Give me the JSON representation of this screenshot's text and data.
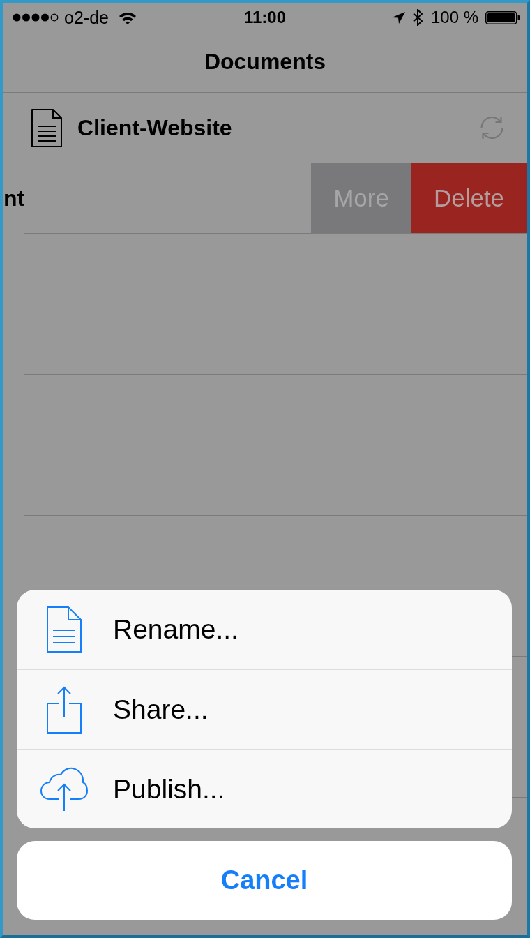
{
  "status_bar": {
    "carrier": "o2-de",
    "time": "11:00",
    "battery_text": "100 %"
  },
  "nav_bar": {
    "title": "Documents"
  },
  "rows": [
    {
      "kind": "document",
      "name": "Client-Website"
    },
    {
      "kind": "swiped",
      "name": "nt",
      "actions": [
        {
          "kind": "more",
          "label": "More"
        },
        {
          "kind": "delete",
          "label": "Delete"
        }
      ]
    }
  ],
  "action_sheet": {
    "items": [
      {
        "kind": "document",
        "label": "Rename..."
      },
      {
        "kind": "share",
        "label": "Share..."
      },
      {
        "kind": "upload",
        "label": "Publish..."
      }
    ],
    "cancel": "Cancel"
  }
}
